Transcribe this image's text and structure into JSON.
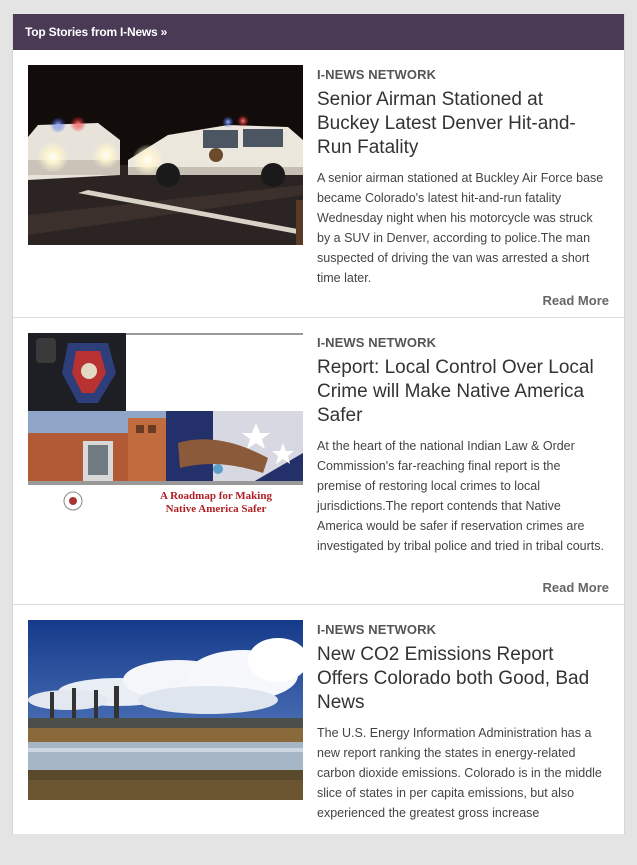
{
  "header": {
    "title": "Top Stories from I-News »"
  },
  "stories": [
    {
      "source": "I-NEWS NETWORK",
      "title": "Senior Airman Stationed at Buckey Latest Denver Hit-and-Run Fatality",
      "summary": "A senior airman stationed at Buckley Air Force base became Colorado's latest hit-and-run fatality Wednesday night when his motorcycle was struck by a SUV in Denver, according to police.The man suspected of driving the van was arrested a short time later.",
      "read_more": "Read More"
    },
    {
      "source": "I-NEWS NETWORK",
      "title": "Report: Local Control Over Local Crime will Make Native America Safer",
      "summary": "At the heart of the national Indian Law & Order Commission's far-reaching final report is the premise of restoring local crimes to local jurisdictions.The report contends that Native America would be safer if reservation crimes are investigated by tribal police and tried in tribal courts.",
      "read_more": "Read More",
      "image_caption_line1": "A Roadmap for Making",
      "image_caption_line2": "Native America Safer"
    },
    {
      "source": "I-NEWS NETWORK",
      "title": "New CO2 Emissions Report Offers Colorado both Good, Bad News",
      "summary": "The U.S. Energy Information Administration has a new report ranking the states in energy-related carbon dioxide emissions. Colorado is in the middle slice of states in per capita emissions, but also experienced the greatest gross increase"
    }
  ]
}
